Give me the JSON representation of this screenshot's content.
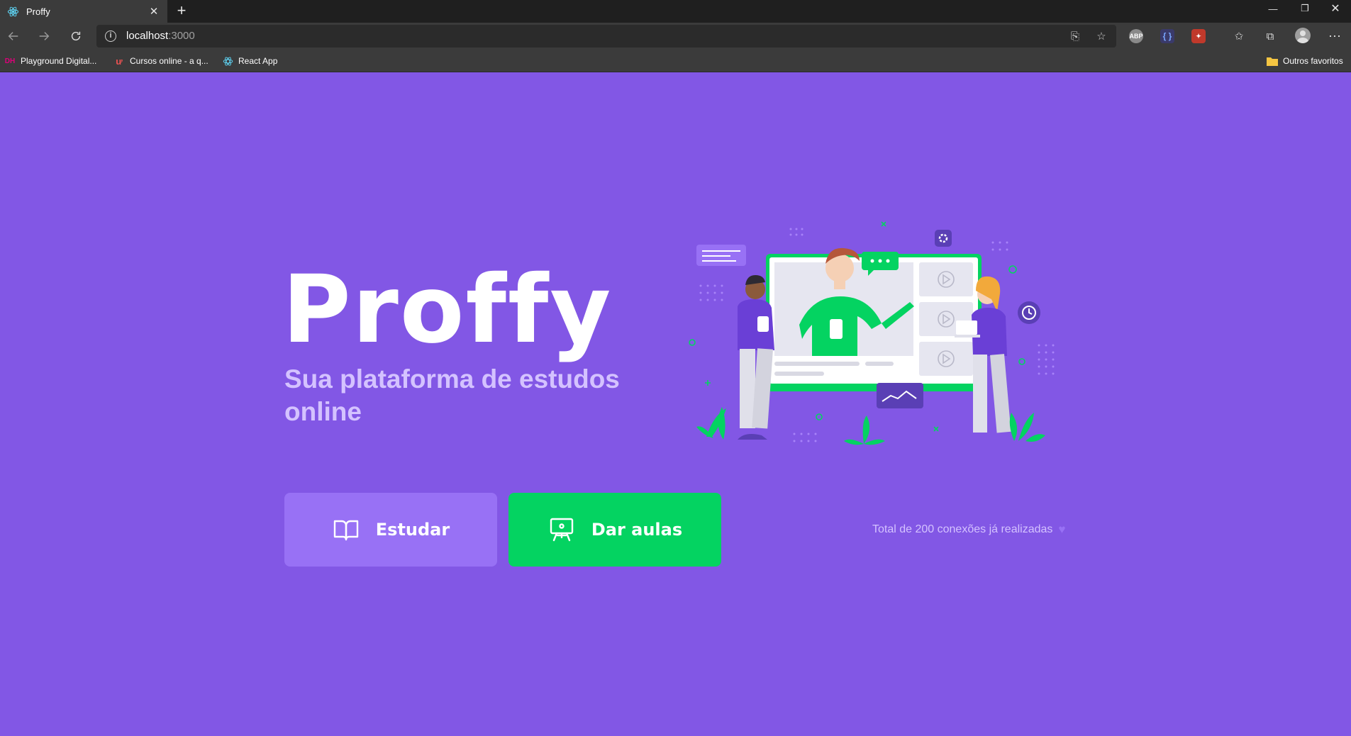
{
  "browser": {
    "tab_title": "Proffy",
    "url_host": "localhost",
    "url_port": ":3000",
    "bookmarks": [
      {
        "label": "Playground Digital...",
        "icon": "digital-house-icon",
        "color": "#e0007a"
      },
      {
        "label": "Cursos online - a q...",
        "icon": "udemy-icon",
        "color": "#ec5252"
      },
      {
        "label": "React App",
        "icon": "react-icon",
        "color": "#5ed3f3"
      }
    ],
    "other_bookmarks": "Outros favoritos",
    "extensions": [
      "abp-icon",
      "json-viewer-icon",
      "screenshot-extension-icon"
    ]
  },
  "landing": {
    "logo": "Proffy",
    "subtitle": "Sua plataforma de estudos online",
    "study_button": "Estudar",
    "give_classes_button": "Dar aulas",
    "total_connections": "Total de 200 conexões já realizadas"
  },
  "colors": {
    "background": "#8257E5",
    "primary_light": "#9871F5",
    "secondary": "#04D361",
    "text_in_primary": "#D4C2FF",
    "white": "#FFFFFF"
  }
}
